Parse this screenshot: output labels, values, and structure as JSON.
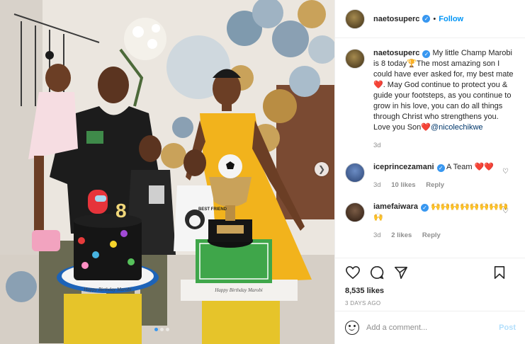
{
  "post": {
    "username": "naetosuperc",
    "separator": "•",
    "follow_label": "Follow",
    "caption_text": " My little Champ Marobi is 8 today🏆The most amazing son I could have ever asked for, my best mate❤️. May God continue to protect you & guide your footsteps, as you continue to grow in his love, you can do all things through Christ who strengthens you. Love you Son❤️",
    "caption_mention": "@nicolechikwe",
    "caption_age": "3d",
    "likes": "8,535 likes",
    "posted_ago": "3 DAYS AGO",
    "carousel_dots": 3
  },
  "comments": [
    {
      "username": "iceprincezamani",
      "text": " A Team ❤️❤️",
      "age": "3d",
      "likes": "10 likes",
      "reply": "Reply"
    },
    {
      "username": "iamefaiwara",
      "text": " 🙌🙌🙌🙌🙌🙌🙌🙌🙌",
      "age": "3d",
      "likes": "2 likes",
      "reply": "Reply"
    }
  ],
  "add_comment": {
    "placeholder": "Add a comment...",
    "post_label": "Post"
  },
  "photo": {
    "cake_number": "8",
    "cake_plaque": "Happy Birthday Marobi",
    "tshirt_text": "BEST FRIEND",
    "board_text": "Happy Birthday Marobi"
  },
  "icons": [
    "verified-badge-icon",
    "heart-icon",
    "comment-icon",
    "share-icon",
    "bookmark-icon",
    "emoji-icon",
    "chevron-right-icon"
  ],
  "colors": {
    "accent": "#0095f6",
    "post_disabled": "#b2dffc",
    "muted": "#8e8e8e",
    "dress": "#f2b31c"
  }
}
